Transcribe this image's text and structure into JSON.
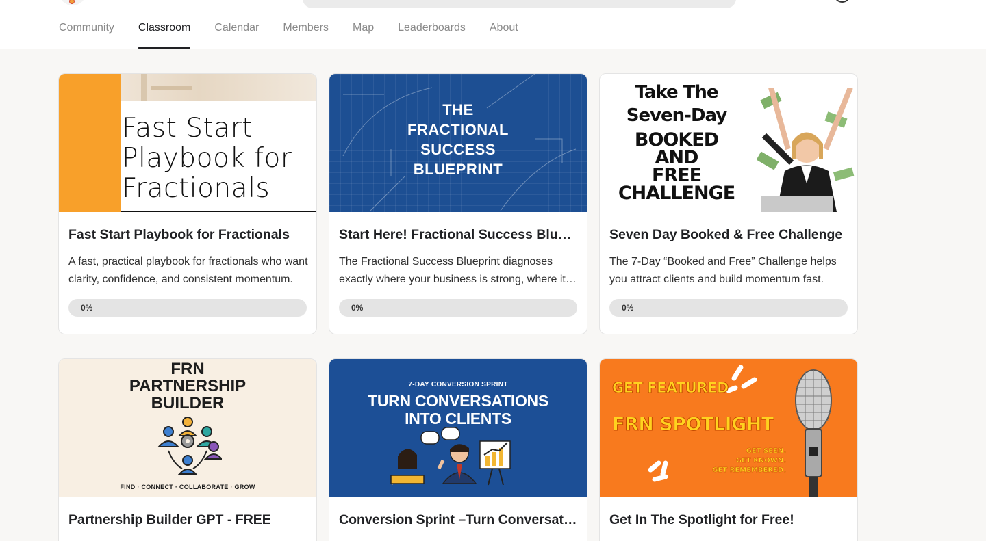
{
  "tabs": [
    {
      "label": "Community",
      "active": false
    },
    {
      "label": "Classroom",
      "active": true
    },
    {
      "label": "Calendar",
      "active": false
    },
    {
      "label": "Members",
      "active": false
    },
    {
      "label": "Map",
      "active": false
    },
    {
      "label": "Leaderboards",
      "active": false
    },
    {
      "label": "About",
      "active": false
    }
  ],
  "courses": [
    {
      "title": "Fast Start Playbook for Fractionals",
      "description": "A fast, practical playbook for fractionals who want clarity, confidence, and consistent momentum.",
      "progress": 0,
      "progress_label": "0%",
      "cover_text": [
        "Fast Start",
        "Playbook for",
        "Fractionals"
      ]
    },
    {
      "title": "Start Here! Fractional Success Blueprint",
      "description": "The Fractional Success Blueprint diagnoses exactly where your business is strong, where it needs work.",
      "progress": 0,
      "progress_label": "0%",
      "cover_text": [
        "THE",
        "FRACTIONAL",
        "SUCCESS",
        "BLUEPRINT"
      ]
    },
    {
      "title": "Seven Day Booked & Free Challenge",
      "description": "The 7-Day “Booked and Free” Challenge helps you attract clients and build momentum fast.",
      "progress": 0,
      "progress_label": "0%",
      "cover_text": [
        "Take The",
        "Seven-Day",
        "BOOKED AND",
        "FREE",
        "CHALLENGE"
      ]
    },
    {
      "title": "Partnership Builder GPT - FREE",
      "cover_text": [
        "FRN",
        "PARTNERSHIP",
        "BUILDER"
      ],
      "cover_tagline": "FIND · CONNECT · COLLABORATE · GROW"
    },
    {
      "title": "Conversion Sprint –Turn Conversations into Clients",
      "cover_kicker": "7-DAY CONVERSION SPRINT",
      "cover_text": [
        "TURN CONVERSATIONS",
        "INTO CLIENTS"
      ]
    },
    {
      "title": "Get In The Spotlight for Free!",
      "cover_text": [
        "GET FEATURED",
        "FRN SPOTLIGHT"
      ],
      "cover_sub": [
        "GET SEEN.",
        "GET KNOWN.",
        "GET REMEMBERED."
      ]
    }
  ],
  "colors": {
    "accent_orange": "#f8a02a",
    "blueprint_blue": "#1d4f93",
    "spotlight_orange": "#f87a1e",
    "progress_track": "#e4e4e4"
  }
}
